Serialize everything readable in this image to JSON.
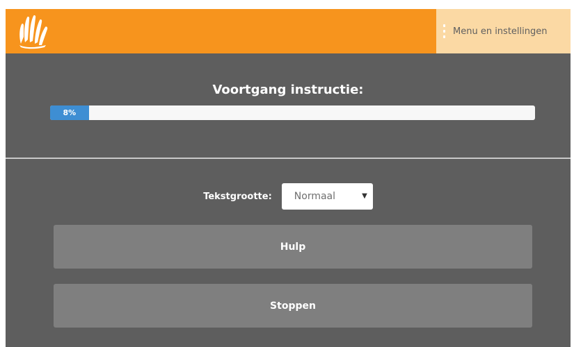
{
  "header": {
    "menu_label": "Menu en instellingen",
    "brand_color": "#f7941d",
    "menu_bg_color": "#fbd9a4"
  },
  "progress": {
    "title": "Voortgang instructie:",
    "percent": 8,
    "percent_label": "8%",
    "fill_color": "#3e8ed3"
  },
  "settings": {
    "text_size_label": "Tekstgrootte:",
    "text_size_value": "Normaal"
  },
  "actions": {
    "help_label": "Hulp",
    "stop_label": "Stoppen"
  },
  "icons": {
    "logo": "hands-logo-icon",
    "menu": "vertical-dots-icon",
    "select_caret": "caret-down-icon"
  }
}
